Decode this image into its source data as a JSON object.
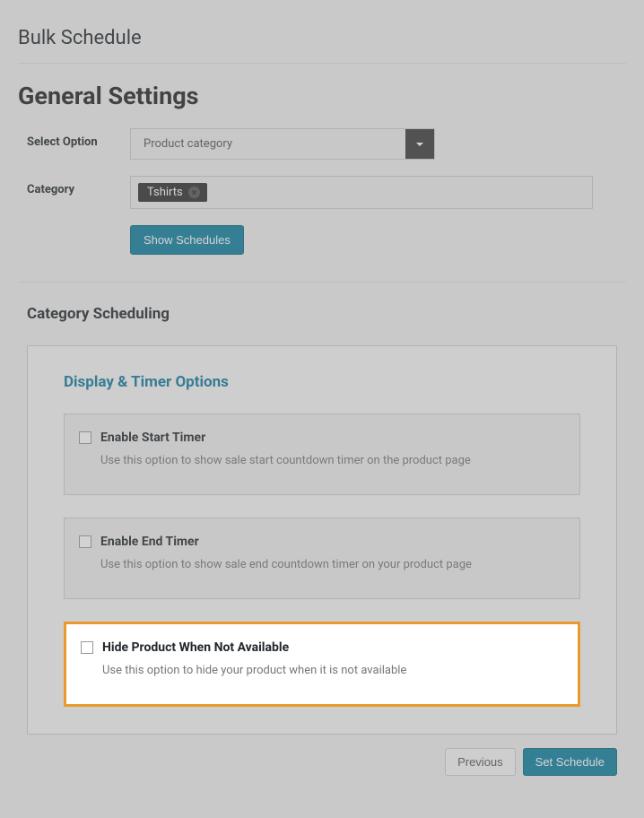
{
  "page_title": "Bulk Schedule",
  "section_title": "General Settings",
  "form": {
    "select_option": {
      "label": "Select Option",
      "value": "Product category"
    },
    "category": {
      "label": "Category",
      "tag": "Tshirts"
    },
    "show_schedules_label": "Show Schedules"
  },
  "subsection_title": "Category Scheduling",
  "panel": {
    "heading": "Display & Timer Options",
    "options": [
      {
        "title": "Enable Start Timer",
        "desc": "Use this option to show sale start countdown timer on the product page"
      },
      {
        "title": "Enable End Timer",
        "desc": "Use this option to show sale end countdown timer on your product page"
      },
      {
        "title": "Hide Product When Not Available",
        "desc": "Use this option to hide your product when it is not available"
      }
    ]
  },
  "footer": {
    "previous": "Previous",
    "set_schedule": "Set Schedule"
  }
}
